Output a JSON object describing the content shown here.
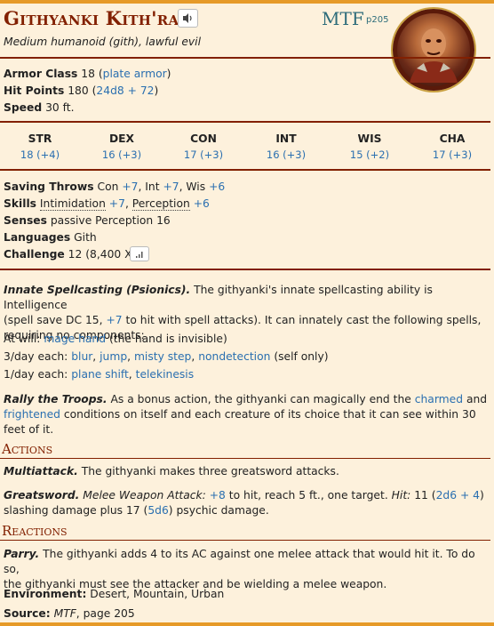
{
  "monster": {
    "name": "Githyanki Kith'rak",
    "source_abbr": "MTF",
    "source_page": "p205",
    "type_line": "Medium humanoid (gith), lawful evil"
  },
  "icons": {
    "audio": "speaker-icon",
    "challenge": "signal-bars-icon",
    "portrait": "githyanki-portrait"
  },
  "colors": {
    "accent": "#822000",
    "bar": "#e69a28",
    "link": "#2a6fb0",
    "background": "#fdf1dc"
  },
  "basics": {
    "ac_label": "Armor Class",
    "ac_value": "18",
    "ac_armor": "plate armor",
    "hp_label": "Hit Points",
    "hp_value": "180",
    "hp_dice": "24d8 + 72",
    "speed_label": "Speed",
    "speed_value": "30 ft."
  },
  "abilities": [
    {
      "name": "STR",
      "value": "18 (+4)"
    },
    {
      "name": "DEX",
      "value": "16 (+3)"
    },
    {
      "name": "CON",
      "value": "17 (+3)"
    },
    {
      "name": "INT",
      "value": "16 (+3)"
    },
    {
      "name": "WIS",
      "value": "15 (+2)"
    },
    {
      "name": "CHA",
      "value": "17 (+3)"
    }
  ],
  "traits": {
    "saves_label": "Saving Throws",
    "saves": [
      {
        "k": "Con",
        "v": "+7"
      },
      {
        "k": "Int",
        "v": "+7"
      },
      {
        "k": "Wis",
        "v": "+6"
      }
    ],
    "skills_label": "Skills",
    "skills": [
      {
        "k": "Intimidation",
        "v": "+7"
      },
      {
        "k": "Perception",
        "v": "+6"
      }
    ],
    "senses_label": "Senses",
    "senses": "passive Perception 16",
    "languages_label": "Languages",
    "languages": "Gith",
    "challenge_label": "Challenge",
    "challenge": "12 (8,400 XP)"
  },
  "spellcasting": {
    "name": "Innate Spellcasting (Psionics).",
    "line1": "The githyanki's innate spellcasting ability is Intelligence",
    "line2a": "(spell save DC 15,",
    "line2_bonus": "+7",
    "line2b": "to hit with spell attacks). It can innately cast the following spells,",
    "line3": "requiring no components:",
    "atwill_label": "At will:",
    "atwill_spell": "mage hand",
    "atwill_note": "(the hand is invisible)",
    "day3_label": "3/day each:",
    "day3_spells": [
      "blur",
      "jump",
      "misty step",
      "nondetection"
    ],
    "day3_note": "(self only)",
    "day1_label": "1/day each:",
    "day1_spells": [
      "plane shift",
      "telekinesis"
    ]
  },
  "rally": {
    "name": "Rally the Troops.",
    "line1a": "As a bonus action, the githyanki can magically end the",
    "cond1": "charmed",
    "line1b": "and",
    "cond2": "frightened",
    "line2": "conditions on itself and each creature of its choice that it can see within 30",
    "line3": "feet of it."
  },
  "actions_header": "Actions",
  "multiattack": {
    "name": "Multiattack.",
    "text": "The githyanki makes three greatsword attacks."
  },
  "greatsword": {
    "name": "Greatsword.",
    "type": "Melee Weapon Attack:",
    "bonus": "+8",
    "mid": "to hit, reach 5 ft., one target.",
    "hit_label": "Hit:",
    "hit_value": "11",
    "hit_dice": "2d6 + 4",
    "line2a": "slashing damage plus 17",
    "psy_dice": "5d6",
    "line2b": "psychic damage."
  },
  "reactions_header": "Reactions",
  "parry": {
    "name": "Parry.",
    "line1": "The githyanki adds 4 to its AC against one melee attack that would hit it. To do so,",
    "line2": "the githyanki must see the attacker and be wielding a melee weapon."
  },
  "footer": {
    "env_label": "Environment:",
    "env_value": "Desert, Mountain, Urban",
    "source_label": "Source:",
    "source_book": "MTF",
    "source_page": ", page 205"
  }
}
